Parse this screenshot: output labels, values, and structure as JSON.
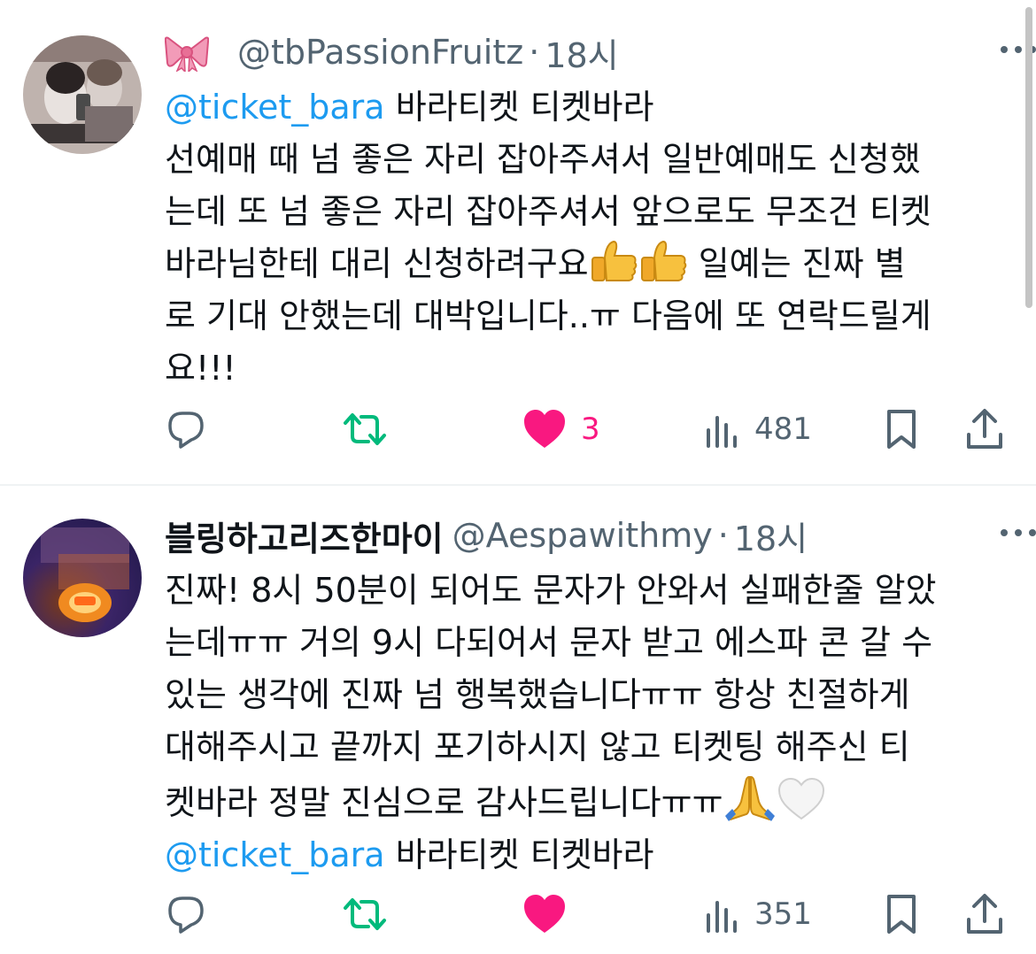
{
  "tweets": [
    {
      "display_name": "",
      "handle": "@tbPassionFruitz",
      "separator": "·",
      "time": "18시",
      "body": {
        "mention": "@ticket_bara",
        "line1_rest": " 바라티켓 티켓바라",
        "line2": "선예매 때 넘 좋은 자리 잡아주셔서 일반예매도 신청했",
        "line3": "는데 또 넘 좋은 자리 잡아주셔서 앞으로도 무조건 티켓",
        "line4_a": "바라님한테 대리 신청하려구요",
        "line4_b": " 일예는 진짜 별",
        "line5": "로 기대 안했는데 대박입니다..ㅠ 다음에 또 연락드릴게",
        "line6": "요!!!"
      },
      "emoji": [
        "thumbs-up-icon",
        "thumbs-up-icon"
      ],
      "actions": {
        "reply_count": "",
        "retweet_count": "",
        "like_count": "3",
        "views": "481",
        "liked": true
      }
    },
    {
      "display_name": "블링하고리즈한마이",
      "handle": "@Aespawithmy",
      "separator": "·",
      "time": "18시",
      "body": {
        "line1": "진짜! 8시 50분이 되어도 문자가 안와서 실패한줄 알았",
        "line2": "는데ㅠㅠ 거의 9시 다되어서 문자 받고 에스파 콘 갈 수",
        "line3": "있는 생각에 진짜 넘 행복했습니다ㅠㅠ 항상 친절하게",
        "line4": "대해주시고 끝까지 포기하시지 않고 티켓팅 해주신 티",
        "line5": "켓바라 정말 진심으로 감사드립니다ㅠㅠ",
        "mention": "@ticket_bara",
        "line6_rest": " 바라티켓 티켓바라"
      },
      "emoji": [
        "folded-hands-icon",
        "white-heart-icon"
      ],
      "actions": {
        "reply_count": "",
        "retweet_count": "",
        "like_count": "",
        "views": "351",
        "liked": true
      }
    }
  ],
  "colors": {
    "accent": "#1d9bf0",
    "like": "#f91880",
    "retweet": "#00ba7c",
    "muted": "#536471",
    "text": "#0f1419"
  }
}
